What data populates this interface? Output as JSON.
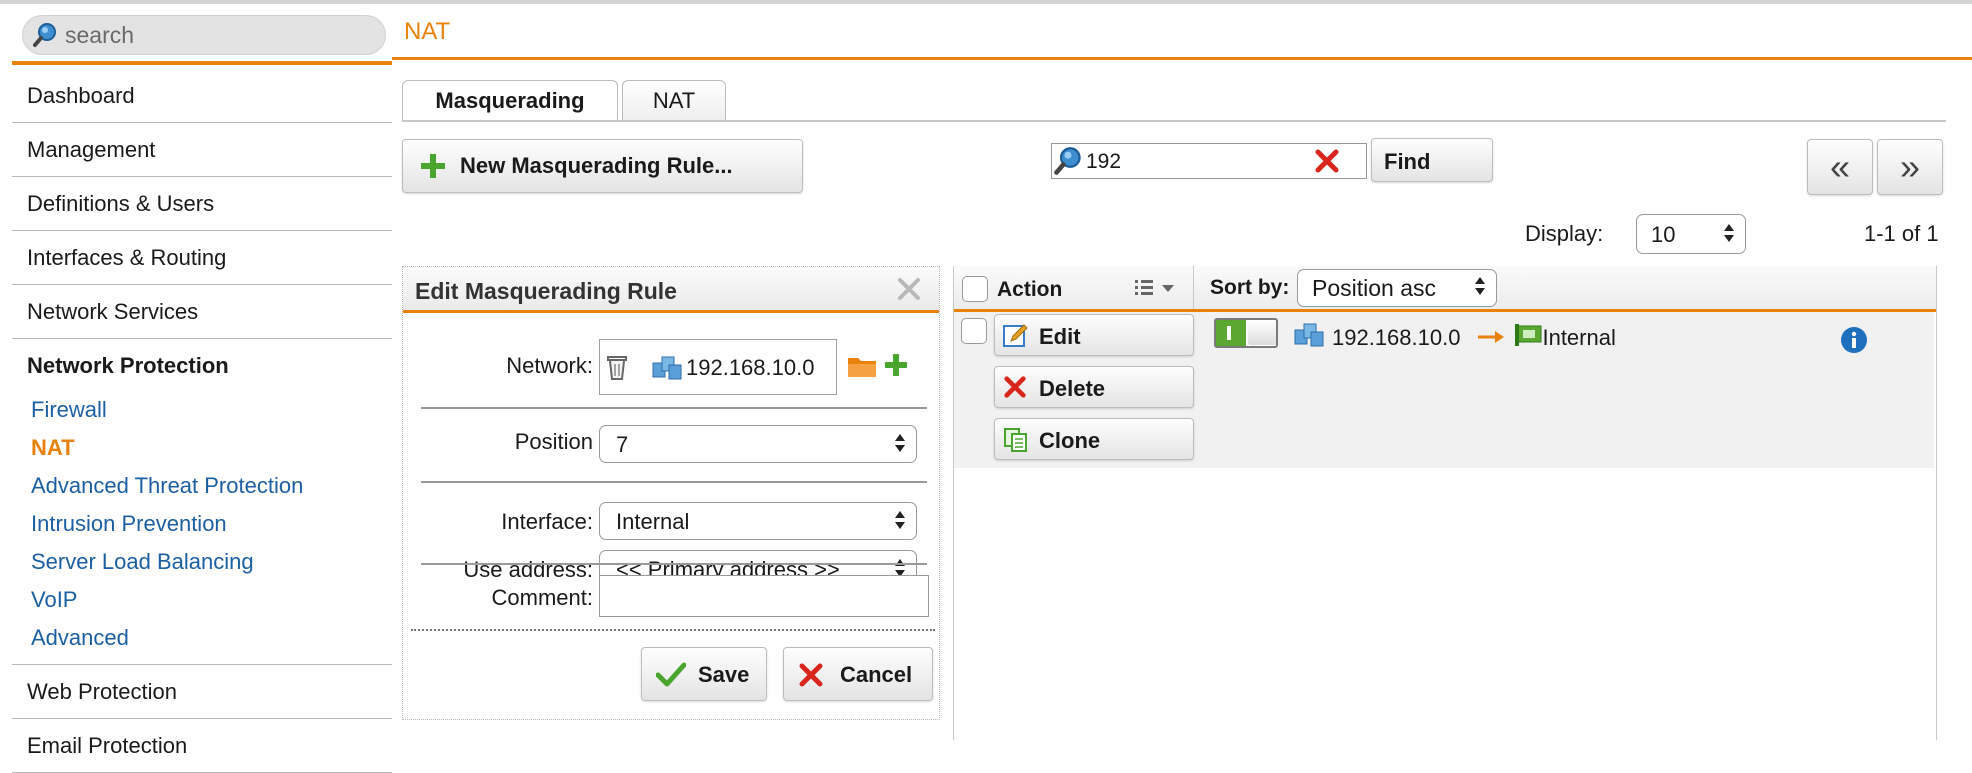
{
  "search": {
    "placeholder": "search"
  },
  "sidebar": {
    "items": [
      {
        "label": "Dashboard"
      },
      {
        "label": "Management"
      },
      {
        "label": "Definitions & Users"
      },
      {
        "label": "Interfaces & Routing"
      },
      {
        "label": "Network Services"
      }
    ],
    "section": {
      "label": "Network Protection",
      "subitems": [
        {
          "label": "Firewall"
        },
        {
          "label": "NAT"
        },
        {
          "label": "Advanced Threat Protection"
        },
        {
          "label": "Intrusion Prevention"
        },
        {
          "label": "Server Load Balancing"
        },
        {
          "label": "VoIP"
        },
        {
          "label": "Advanced"
        }
      ]
    },
    "after_items": [
      {
        "label": "Web Protection"
      },
      {
        "label": "Email Protection"
      }
    ]
  },
  "header": {
    "title": "NAT"
  },
  "tabs": [
    {
      "label": "Masquerading"
    },
    {
      "label": "NAT"
    }
  ],
  "toolbar": {
    "new_rule_label": "New Masquerading Rule...",
    "filter_value": "192",
    "find_label": "Find",
    "prev_label": "«",
    "next_label": "»",
    "display_label": "Display:",
    "display_value": "10",
    "count_text": "1-1 of 1"
  },
  "edit_panel": {
    "title": "Edit Masquerading Rule",
    "network_label": "Network:",
    "network_value": "192.168.10.0",
    "position_label": "Position",
    "position_value": "7",
    "interface_label": "Interface:",
    "interface_value": "Internal",
    "use_address_label": "Use address:",
    "use_address_value": "<< Primary address >>",
    "comment_label": "Comment:",
    "comment_value": "",
    "save_label": "Save",
    "cancel_label": "Cancel"
  },
  "table": {
    "action_header": "Action",
    "sort_by_label": "Sort by:",
    "sort_value": "Position asc",
    "rows": [
      {
        "edit_label": "Edit",
        "delete_label": "Delete",
        "clone_label": "Clone",
        "enabled": true,
        "network": "192.168.10.0",
        "interface": "Internal"
      }
    ]
  },
  "colors": {
    "accent": "#e8820c",
    "link": "#1c5fa3",
    "toggle_on": "#5aa832",
    "danger": "#d9261c",
    "info": "#1f6fbf"
  },
  "icons": [
    "search-icon",
    "plus-icon",
    "clear-icon",
    "trash-icon",
    "network-icon",
    "folder-icon",
    "check-icon",
    "cancel-icon",
    "edit-icon",
    "delete-icon",
    "clone-icon",
    "arrow-right-icon",
    "interface-icon",
    "info-icon",
    "columns-icon",
    "close-icon"
  ]
}
